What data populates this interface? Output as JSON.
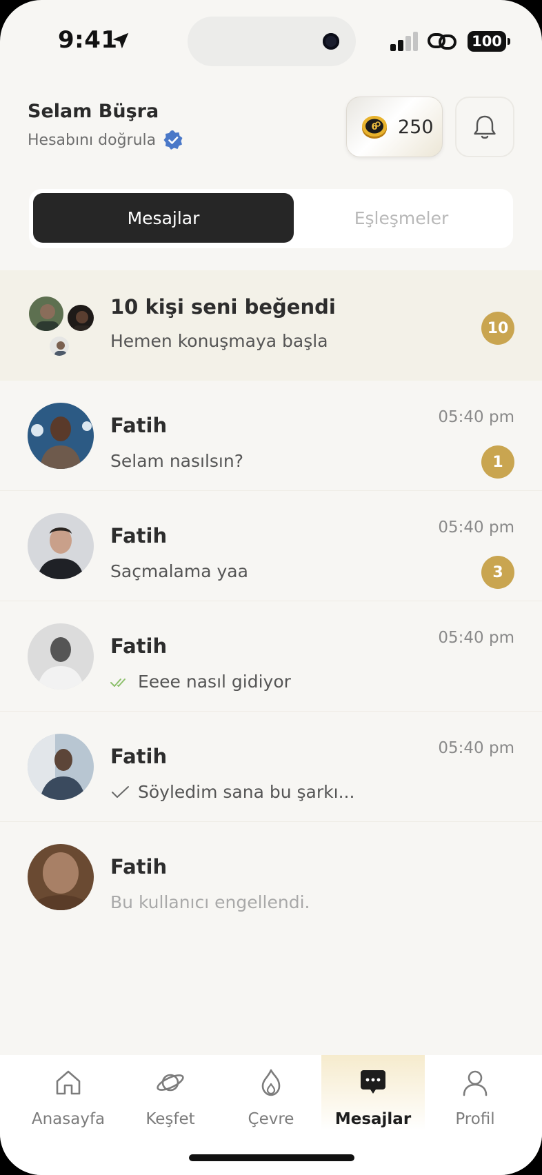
{
  "status_bar": {
    "time": "9:41",
    "battery": "100"
  },
  "header": {
    "greeting": "Selam Büşra",
    "verify_label": "Hesabını doğrula",
    "coins": "250"
  },
  "tabs": {
    "messages": "Mesajlar",
    "matches": "Eşleşmeler",
    "active": "Mesajlar"
  },
  "likes": {
    "title": "10 kişi seni beğendi",
    "subtitle": "Hemen konuşmaya başla",
    "badge": "10"
  },
  "conversations": [
    {
      "name": "Fatih",
      "message": "Selam nasılsın?",
      "time": "05:40 pm",
      "unread": "1"
    },
    {
      "name": "Fatih",
      "message": "Saçmalama yaa",
      "time": "05:40 pm",
      "unread": "3"
    },
    {
      "name": "Fatih",
      "message": "Eeee nasıl gidiyor",
      "time": "05:40 pm",
      "status": "read"
    },
    {
      "name": "Fatih",
      "message": "Söyledim sana bu şarkı...",
      "time": "05:40 pm",
      "status": "sent"
    },
    {
      "name": "Fatih",
      "message": "Bu kullanıcı engellendi.",
      "status": "blocked"
    }
  ],
  "nav": {
    "home": "Anasayfa",
    "explore": "Keşfet",
    "around": "Çevre",
    "messages": "Mesajlar",
    "profile": "Profil",
    "active": "Mesajlar"
  },
  "colors": {
    "accent": "#c9a550",
    "dark": "#262626",
    "background": "#f7f6f3",
    "verified": "#4a78c8"
  }
}
